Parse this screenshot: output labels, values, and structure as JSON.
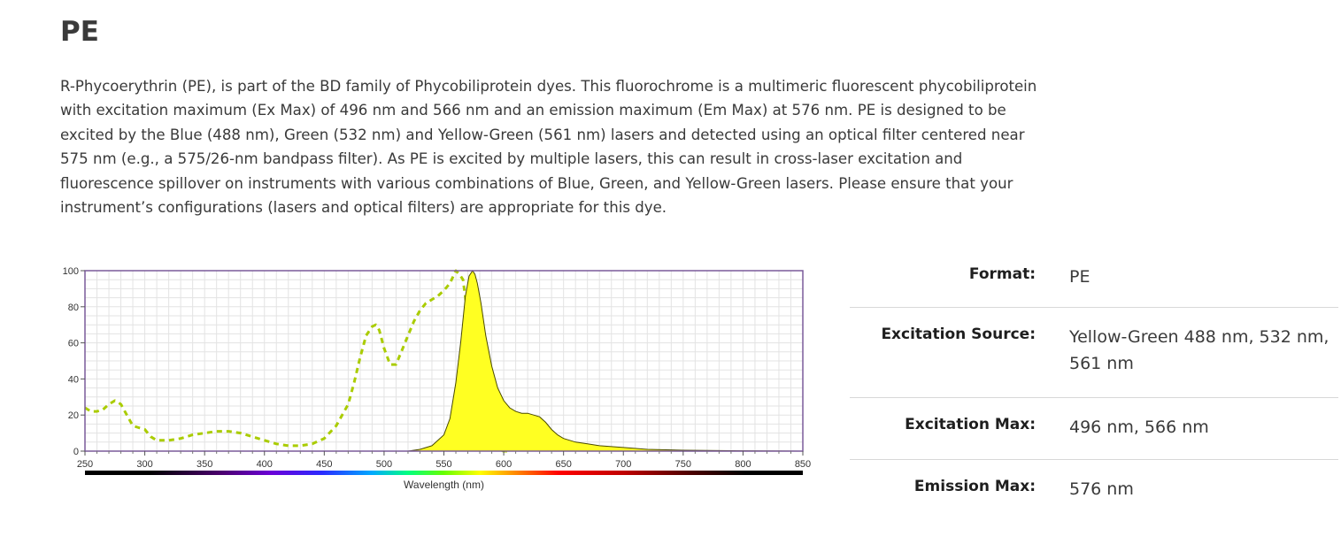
{
  "page": {
    "title": "PE",
    "description": "R-Phycoerythrin (PE), is part of the BD family of Phycobiliprotein dyes. This fluorochrome is a multimeric fluorescent phycobiliprotein with excitation maximum (Ex Max) of 496 nm and 566 nm and an emission maximum (Em Max) at 576 nm. PE is designed to be excited by the Blue (488 nm), Green (532 nm) and Yellow-Green (561 nm) lasers and detected using an optical filter centered near 575 nm (e.g., a 575/26-nm bandpass filter). As PE is excited by multiple lasers, this can result in cross-laser excitation and fluorescence spillover on instruments with various combinations of Blue, Green, and Yellow-Green lasers. Please ensure that your instrument’s configurations (lasers and optical filters) are appropriate for this dye."
  },
  "properties": [
    {
      "label": "Format:",
      "value": "PE"
    },
    {
      "label": "Excitation Source:",
      "value": "Yellow-Green 488 nm, 532 nm, 561 nm"
    },
    {
      "label": "Excitation Max:",
      "value": "496 nm, 566 nm"
    },
    {
      "label": "Emission Max:",
      "value": "576 nm"
    }
  ],
  "colors": {
    "emission_fill": "#ffff22",
    "emission_line": "#4a4a00",
    "excitation_line": "#aacc00",
    "plot_border": "#7a5a9a",
    "grid": "#e3e3e3"
  },
  "chart_data": {
    "type": "area",
    "title": "",
    "xlabel": "Wavelength (nm)",
    "ylabel": "",
    "xlim": [
      250,
      850
    ],
    "ylim": [
      0,
      100
    ],
    "xticks": [
      250,
      300,
      350,
      400,
      450,
      500,
      550,
      600,
      650,
      700,
      750,
      800,
      850
    ],
    "yticks": [
      0,
      20,
      40,
      60,
      80,
      100
    ],
    "grid": true,
    "legend": "none",
    "wavelength_spectrum_bar": true,
    "series": [
      {
        "role": "excitation",
        "style": "dashed",
        "x": [
          250,
          255,
          260,
          265,
          270,
          275,
          280,
          285,
          290,
          295,
          300,
          305,
          310,
          320,
          330,
          340,
          350,
          360,
          370,
          380,
          390,
          400,
          410,
          420,
          430,
          440,
          450,
          460,
          470,
          475,
          480,
          485,
          490,
          493,
          496,
          500,
          505,
          510,
          515,
          520,
          525,
          530,
          535,
          540,
          545,
          550,
          555,
          560,
          563,
          566,
          568,
          570,
          573,
          576,
          580,
          585,
          590,
          595,
          600,
          605
        ],
        "y": [
          24,
          22,
          22,
          23,
          26,
          28,
          26,
          20,
          14,
          13,
          12,
          8,
          6,
          6,
          7,
          9,
          10,
          11,
          11,
          10,
          8,
          6,
          4,
          3,
          3,
          4,
          7,
          14,
          26,
          38,
          52,
          64,
          69,
          70,
          67,
          57,
          48,
          48,
          56,
          64,
          72,
          78,
          82,
          84,
          86,
          89,
          93,
          100,
          98,
          95,
          85,
          70,
          52,
          36,
          20,
          8,
          3,
          1,
          0,
          0
        ]
      },
      {
        "role": "emission",
        "style": "filled",
        "x": [
          450,
          500,
          520,
          530,
          540,
          550,
          555,
          560,
          564,
          568,
          571,
          574,
          576,
          578,
          581,
          585,
          590,
          595,
          600,
          605,
          610,
          615,
          620,
          625,
          630,
          635,
          640,
          645,
          650,
          660,
          670,
          680,
          700,
          720,
          750,
          800,
          850
        ],
        "y": [
          0,
          0,
          0,
          1,
          3,
          9,
          18,
          38,
          60,
          86,
          97,
          100,
          98,
          93,
          82,
          64,
          47,
          35,
          28,
          24,
          22,
          21,
          21,
          20,
          19,
          16,
          12,
          9,
          7,
          5,
          4,
          3,
          2,
          1,
          0.5,
          0.2,
          0
        ]
      }
    ]
  }
}
